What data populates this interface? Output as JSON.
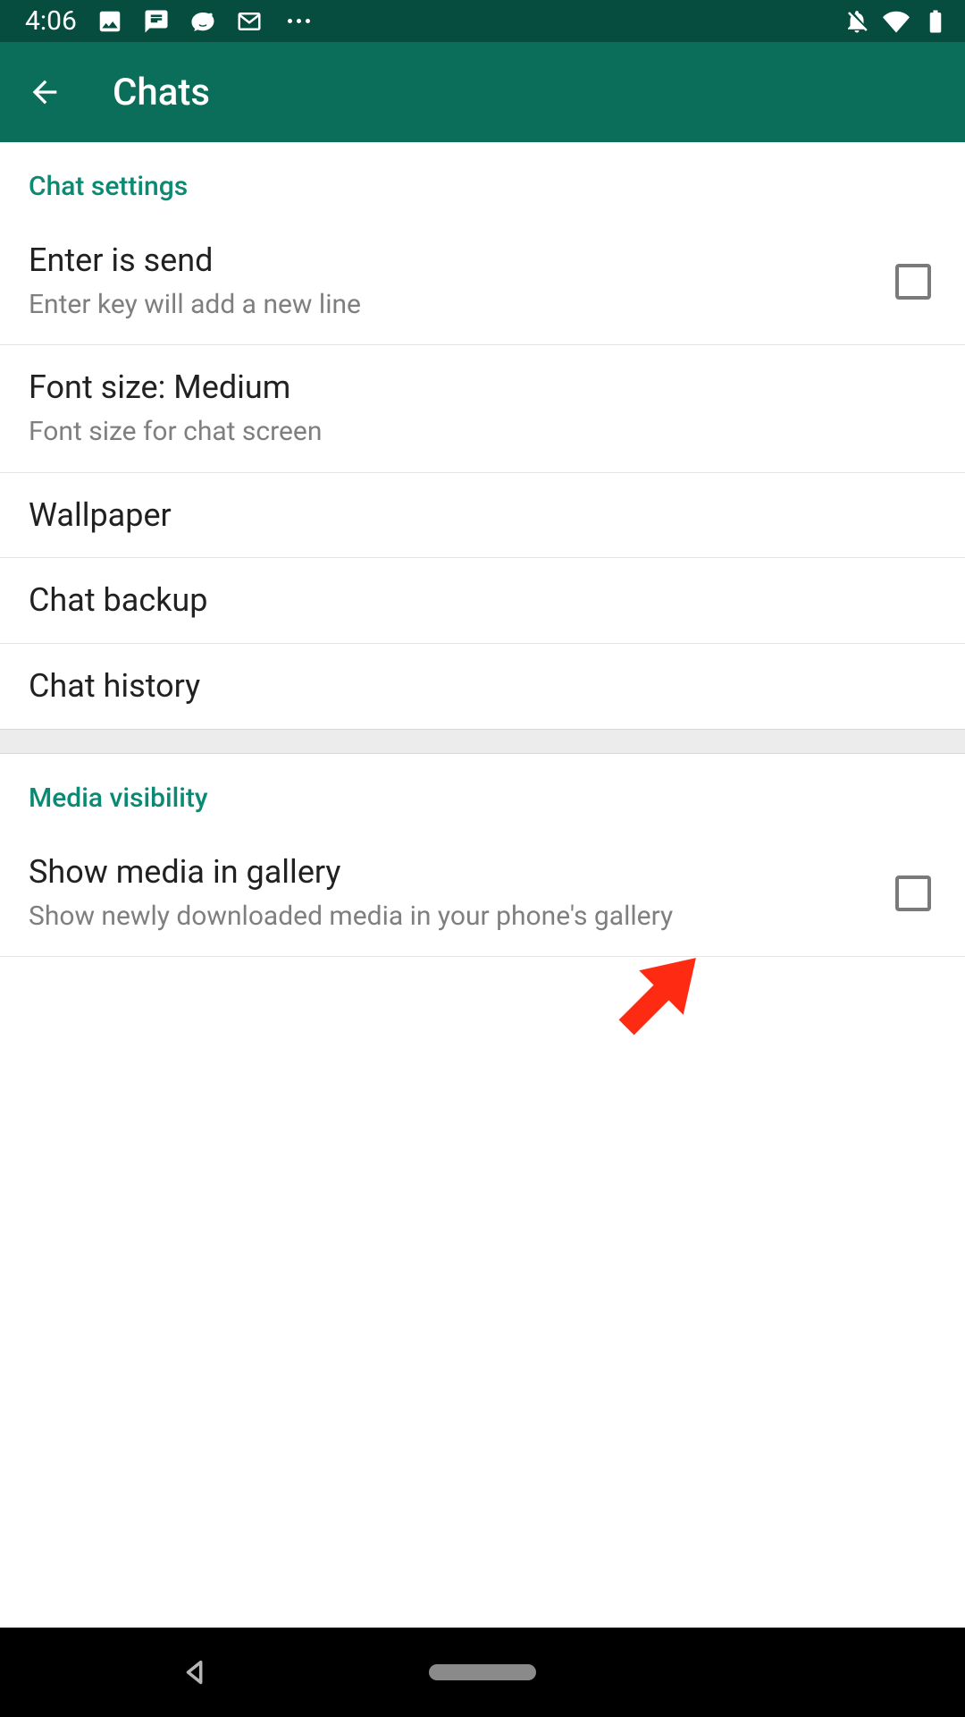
{
  "status_bar": {
    "time": "4:06"
  },
  "app_bar": {
    "title": "Chats"
  },
  "sections": {
    "chat_settings": {
      "header": "Chat settings",
      "enter_is_send": {
        "title": "Enter is send",
        "subtitle": "Enter key will add a new line"
      },
      "font_size": {
        "title": "Font size: Medium",
        "subtitle": "Font size for chat screen"
      },
      "wallpaper": {
        "title": "Wallpaper"
      },
      "chat_backup": {
        "title": "Chat backup"
      },
      "chat_history": {
        "title": "Chat history"
      }
    },
    "media_visibility": {
      "header": "Media visibility",
      "show_media": {
        "title": "Show media in gallery",
        "subtitle": "Show newly downloaded media in your phone's gallery"
      }
    }
  }
}
